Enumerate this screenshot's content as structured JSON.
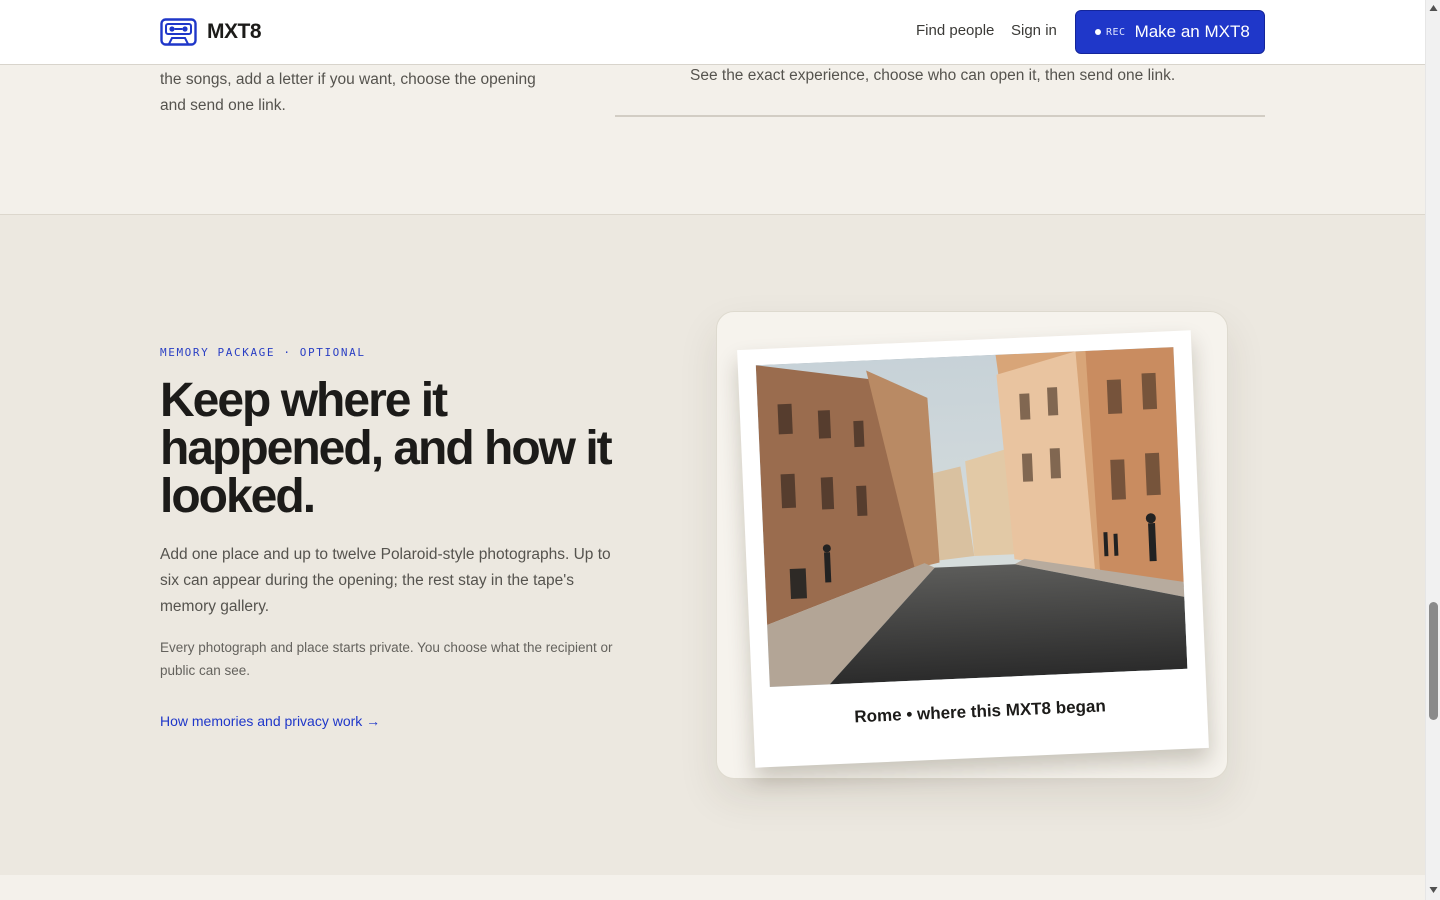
{
  "header": {
    "brand": "MXT8",
    "logo_icon": "cassette-tape-icon",
    "nav": {
      "find_people": "Find people",
      "sign_in": "Sign in"
    },
    "cta": {
      "rec_label": "REC",
      "label": "Make an MXT8"
    }
  },
  "intro": {
    "left_text": "the songs, add a letter if you want, choose the opening and send one link.",
    "right_text": "See the exact experience, choose who can open it, then send one link."
  },
  "memory": {
    "eyebrow": "MEMORY PACKAGE · OPTIONAL",
    "headline": "Keep where it happened, and how it looked.",
    "body": "Add one place and up to twelve Polaroid-style photographs. Up to six can appear during the opening; the rest stay in the tape's memory gallery.",
    "note": "Every photograph and place starts private. You choose what the recipient or public can see.",
    "link": "How memories and privacy work →",
    "polaroid_caption": "Rome • where this MXT8 began"
  },
  "colors": {
    "accent": "#1f37c9",
    "page_background": "#f3f0ea",
    "section_background": "#ece8e0",
    "heading_text": "#1c1b19",
    "body_text": "#55534e"
  }
}
